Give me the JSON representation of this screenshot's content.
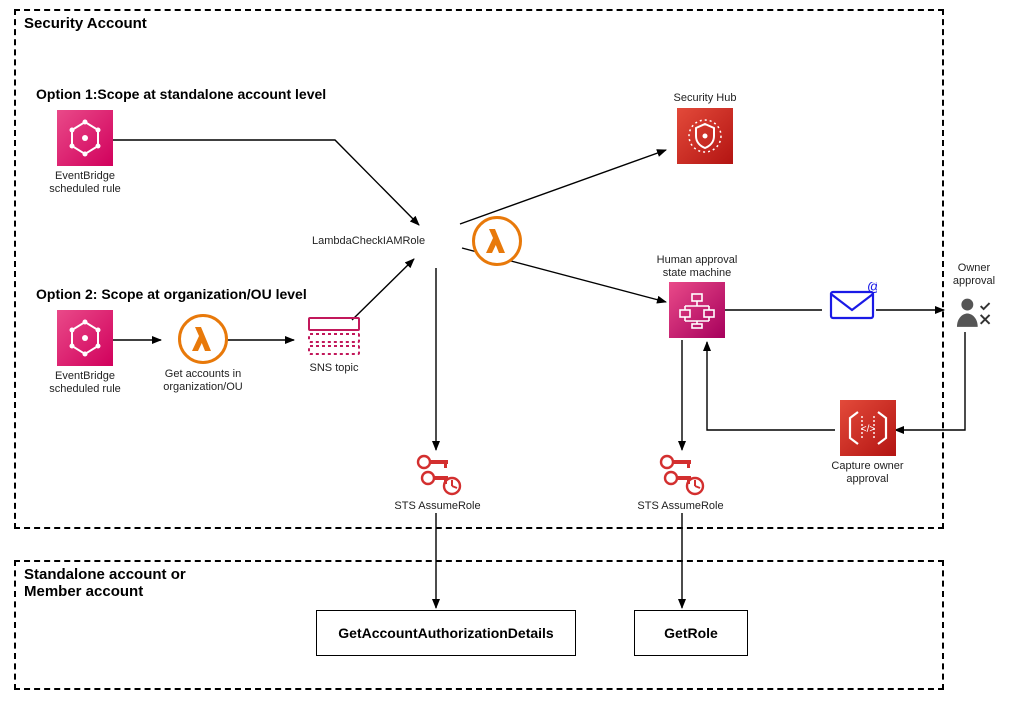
{
  "containers": {
    "security": "Security Account",
    "member": "Standalone account or\nMember account"
  },
  "options": {
    "opt1": "Option 1:Scope at standalone account level",
    "opt2": "Option 2: Scope at organization/OU level"
  },
  "nodes": {
    "eb1": "EventBridge\nscheduled rule",
    "eb2": "EventBridge\nscheduled rule",
    "getAccounts": "Get accounts in\norganization/OU",
    "sns": "SNS topic",
    "lambdaCheck": "LambdaCheckIAMRole",
    "securityHub": "Security Hub",
    "stateMachine": "Human approval\nstate machine",
    "sts1": "STS AssumeRole",
    "sts2": "STS AssumeRole",
    "email": "",
    "owner": "Owner\napproval",
    "capture": "Capture owner\napproval"
  },
  "actions": {
    "getAuthDetails": "GetAccountAuthorizationDetails",
    "getRole": "GetRole"
  }
}
